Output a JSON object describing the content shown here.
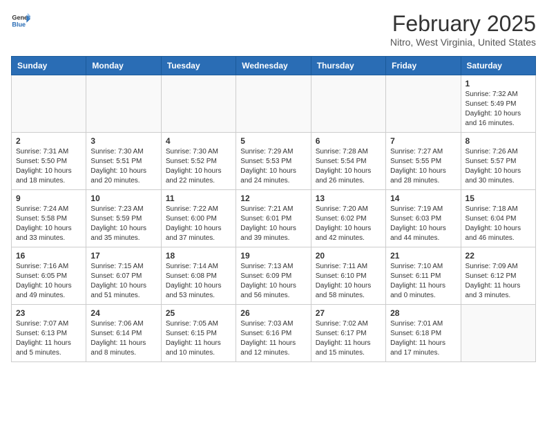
{
  "header": {
    "logo_general": "General",
    "logo_blue": "Blue",
    "month": "February 2025",
    "location": "Nitro, West Virginia, United States"
  },
  "weekdays": [
    "Sunday",
    "Monday",
    "Tuesday",
    "Wednesday",
    "Thursday",
    "Friday",
    "Saturday"
  ],
  "weeks": [
    [
      {
        "day": "",
        "info": ""
      },
      {
        "day": "",
        "info": ""
      },
      {
        "day": "",
        "info": ""
      },
      {
        "day": "",
        "info": ""
      },
      {
        "day": "",
        "info": ""
      },
      {
        "day": "",
        "info": ""
      },
      {
        "day": "1",
        "info": "Sunrise: 7:32 AM\nSunset: 5:49 PM\nDaylight: 10 hours and 16 minutes."
      }
    ],
    [
      {
        "day": "2",
        "info": "Sunrise: 7:31 AM\nSunset: 5:50 PM\nDaylight: 10 hours and 18 minutes."
      },
      {
        "day": "3",
        "info": "Sunrise: 7:30 AM\nSunset: 5:51 PM\nDaylight: 10 hours and 20 minutes."
      },
      {
        "day": "4",
        "info": "Sunrise: 7:30 AM\nSunset: 5:52 PM\nDaylight: 10 hours and 22 minutes."
      },
      {
        "day": "5",
        "info": "Sunrise: 7:29 AM\nSunset: 5:53 PM\nDaylight: 10 hours and 24 minutes."
      },
      {
        "day": "6",
        "info": "Sunrise: 7:28 AM\nSunset: 5:54 PM\nDaylight: 10 hours and 26 minutes."
      },
      {
        "day": "7",
        "info": "Sunrise: 7:27 AM\nSunset: 5:55 PM\nDaylight: 10 hours and 28 minutes."
      },
      {
        "day": "8",
        "info": "Sunrise: 7:26 AM\nSunset: 5:57 PM\nDaylight: 10 hours and 30 minutes."
      }
    ],
    [
      {
        "day": "9",
        "info": "Sunrise: 7:24 AM\nSunset: 5:58 PM\nDaylight: 10 hours and 33 minutes."
      },
      {
        "day": "10",
        "info": "Sunrise: 7:23 AM\nSunset: 5:59 PM\nDaylight: 10 hours and 35 minutes."
      },
      {
        "day": "11",
        "info": "Sunrise: 7:22 AM\nSunset: 6:00 PM\nDaylight: 10 hours and 37 minutes."
      },
      {
        "day": "12",
        "info": "Sunrise: 7:21 AM\nSunset: 6:01 PM\nDaylight: 10 hours and 39 minutes."
      },
      {
        "day": "13",
        "info": "Sunrise: 7:20 AM\nSunset: 6:02 PM\nDaylight: 10 hours and 42 minutes."
      },
      {
        "day": "14",
        "info": "Sunrise: 7:19 AM\nSunset: 6:03 PM\nDaylight: 10 hours and 44 minutes."
      },
      {
        "day": "15",
        "info": "Sunrise: 7:18 AM\nSunset: 6:04 PM\nDaylight: 10 hours and 46 minutes."
      }
    ],
    [
      {
        "day": "16",
        "info": "Sunrise: 7:16 AM\nSunset: 6:05 PM\nDaylight: 10 hours and 49 minutes."
      },
      {
        "day": "17",
        "info": "Sunrise: 7:15 AM\nSunset: 6:07 PM\nDaylight: 10 hours and 51 minutes."
      },
      {
        "day": "18",
        "info": "Sunrise: 7:14 AM\nSunset: 6:08 PM\nDaylight: 10 hours and 53 minutes."
      },
      {
        "day": "19",
        "info": "Sunrise: 7:13 AM\nSunset: 6:09 PM\nDaylight: 10 hours and 56 minutes."
      },
      {
        "day": "20",
        "info": "Sunrise: 7:11 AM\nSunset: 6:10 PM\nDaylight: 10 hours and 58 minutes."
      },
      {
        "day": "21",
        "info": "Sunrise: 7:10 AM\nSunset: 6:11 PM\nDaylight: 11 hours and 0 minutes."
      },
      {
        "day": "22",
        "info": "Sunrise: 7:09 AM\nSunset: 6:12 PM\nDaylight: 11 hours and 3 minutes."
      }
    ],
    [
      {
        "day": "23",
        "info": "Sunrise: 7:07 AM\nSunset: 6:13 PM\nDaylight: 11 hours and 5 minutes."
      },
      {
        "day": "24",
        "info": "Sunrise: 7:06 AM\nSunset: 6:14 PM\nDaylight: 11 hours and 8 minutes."
      },
      {
        "day": "25",
        "info": "Sunrise: 7:05 AM\nSunset: 6:15 PM\nDaylight: 11 hours and 10 minutes."
      },
      {
        "day": "26",
        "info": "Sunrise: 7:03 AM\nSunset: 6:16 PM\nDaylight: 11 hours and 12 minutes."
      },
      {
        "day": "27",
        "info": "Sunrise: 7:02 AM\nSunset: 6:17 PM\nDaylight: 11 hours and 15 minutes."
      },
      {
        "day": "28",
        "info": "Sunrise: 7:01 AM\nSunset: 6:18 PM\nDaylight: 11 hours and 17 minutes."
      },
      {
        "day": "",
        "info": ""
      }
    ]
  ]
}
